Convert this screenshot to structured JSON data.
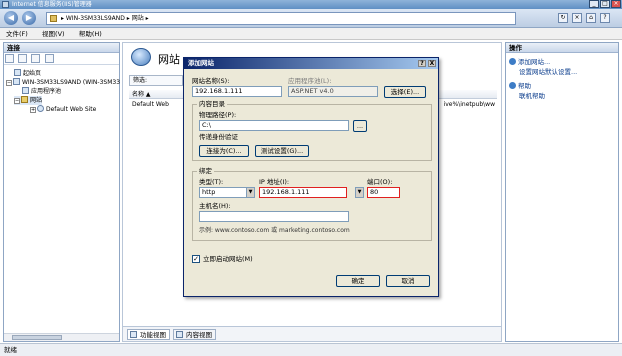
{
  "window": {
    "title": "Internet 信息服务(IIS)管理器"
  },
  "address": {
    "path": "▸ WIN-3SM33LS9AND ▸ 网站 ▸"
  },
  "menu": [
    "文件(F)",
    "视图(V)",
    "帮助(H)"
  ],
  "connections": {
    "header": "连接",
    "tree": [
      {
        "label": "起始页"
      },
      {
        "label": "WIN-3SM33LS9AND (WIN-3SM33"
      },
      {
        "label": "应用程序池"
      },
      {
        "label": "网站"
      },
      {
        "label": "Default Web Site"
      }
    ]
  },
  "center": {
    "title": "网站",
    "filter_label": "筛选:",
    "col_name": "名称 ▲",
    "row_name": "Default Web",
    "row_path": "ive%\\inetpub\\ww",
    "tab_features": "功能视图",
    "tab_content": "内容视图"
  },
  "actions": {
    "header": "操作",
    "items": [
      "添加网站...",
      "设置网站默认设置...",
      "帮助",
      "联机帮助"
    ]
  },
  "status": {
    "text": "就绪"
  },
  "dialog": {
    "title": "添加网站",
    "help_btn": "?",
    "close_btn": "X",
    "site_name_label": "网站名称(S):",
    "site_name_value": "192.168.1.111",
    "app_pool_label": "应用程序池(L):",
    "app_pool_value": "ASP.NET v4.0",
    "select_btn": "选择(E)...",
    "content_dir_label": "内容目录",
    "physical_path_label": "物理路径(P):",
    "physical_path_value": "C:\\",
    "browse_btn": "...",
    "passthrough_label": "传递身份验证",
    "connect_as_btn": "连接为(C)...",
    "test_settings_btn": "测试设置(G)...",
    "binding_label": "绑定",
    "type_label": "类型(T):",
    "type_value": "http",
    "ip_label": "IP 地址(I):",
    "ip_value": "192.168.1.111",
    "port_label": "端口(O):",
    "port_value": "80",
    "hostname_label": "主机名(H):",
    "hostname_value": "",
    "example_text": "示例: www.contoso.com 或 marketing.contoso.com",
    "start_immediately_label": "立即启动网站(M)",
    "ok_btn": "确定",
    "cancel_btn": "取消"
  },
  "colors": {
    "highlight": "#e02020",
    "dialog_title": "#0a246a",
    "dialog_bg": "#ece9d8"
  }
}
